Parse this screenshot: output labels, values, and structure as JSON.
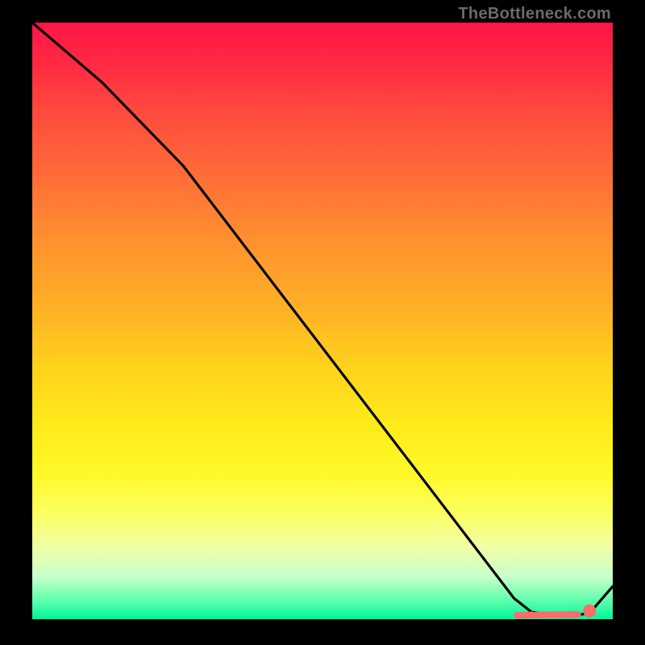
{
  "watermark": "TheBottleneck.com",
  "chart_data": {
    "type": "line",
    "title": "",
    "xlabel": "",
    "ylabel": "",
    "xlim": [
      0,
      100
    ],
    "ylim": [
      0,
      100
    ],
    "series": [
      {
        "name": "curve",
        "color": "#000000",
        "x": [
          0,
          12,
          22,
          26,
          83,
          86,
          90,
          93,
          96,
          100
        ],
        "y": [
          100,
          90,
          80,
          76,
          3.5,
          1.2,
          0.6,
          0.6,
          1.0,
          5.5
        ]
      }
    ],
    "markers": {
      "color": "#ff6a6a",
      "stroke": "#ff6a6a",
      "band_y": 0.8,
      "points_x": [
        86,
        88,
        89.5,
        91,
        92,
        93.5,
        96
      ],
      "big_point_x": 96
    }
  }
}
